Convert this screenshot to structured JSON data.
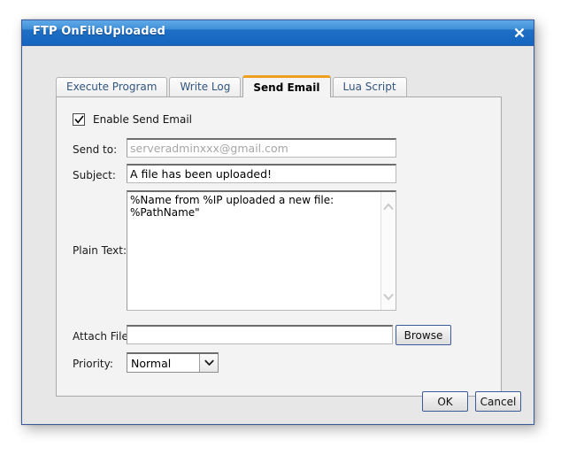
{
  "window": {
    "title": "FTP OnFileUploaded",
    "close_icon": "close-icon"
  },
  "tabs": [
    {
      "label": "Execute Program",
      "active": false
    },
    {
      "label": "Write Log",
      "active": false
    },
    {
      "label": "Send Email",
      "active": true
    },
    {
      "label": "Lua Script",
      "active": false
    }
  ],
  "form": {
    "enable": {
      "label": "Enable Send Email",
      "checked": true,
      "check_icon": "checkmark-icon"
    },
    "send_to": {
      "label": "Send to:",
      "value": "",
      "placeholder": "serveradminxxx@gmail.com"
    },
    "subject": {
      "label": "Subject:",
      "value": "A file has been uploaded!",
      "placeholder": ""
    },
    "plain_text": {
      "label": "Plain Text:",
      "value": "%Name from %IP uploaded a new file:\n%PathName\""
    },
    "attach_file": {
      "label": "Attach File:",
      "value": "",
      "placeholder": "",
      "browse_label": "Browse"
    },
    "priority": {
      "label": "Priority:",
      "selected": "Normal",
      "options": [
        "Normal"
      ],
      "arrow_icon": "chevron-down-icon"
    }
  },
  "footer": {
    "ok_label": "OK",
    "cancel_label": "Cancel"
  },
  "colors": {
    "titlebar_blue": "#1565c0",
    "active_tab_accent": "#f0a020",
    "dialog_border": "#3b5a9a",
    "panel_bg": "#f3f3f3",
    "dialog_bg": "#e7e7e7",
    "placeholder_text": "#a6a6a6"
  }
}
